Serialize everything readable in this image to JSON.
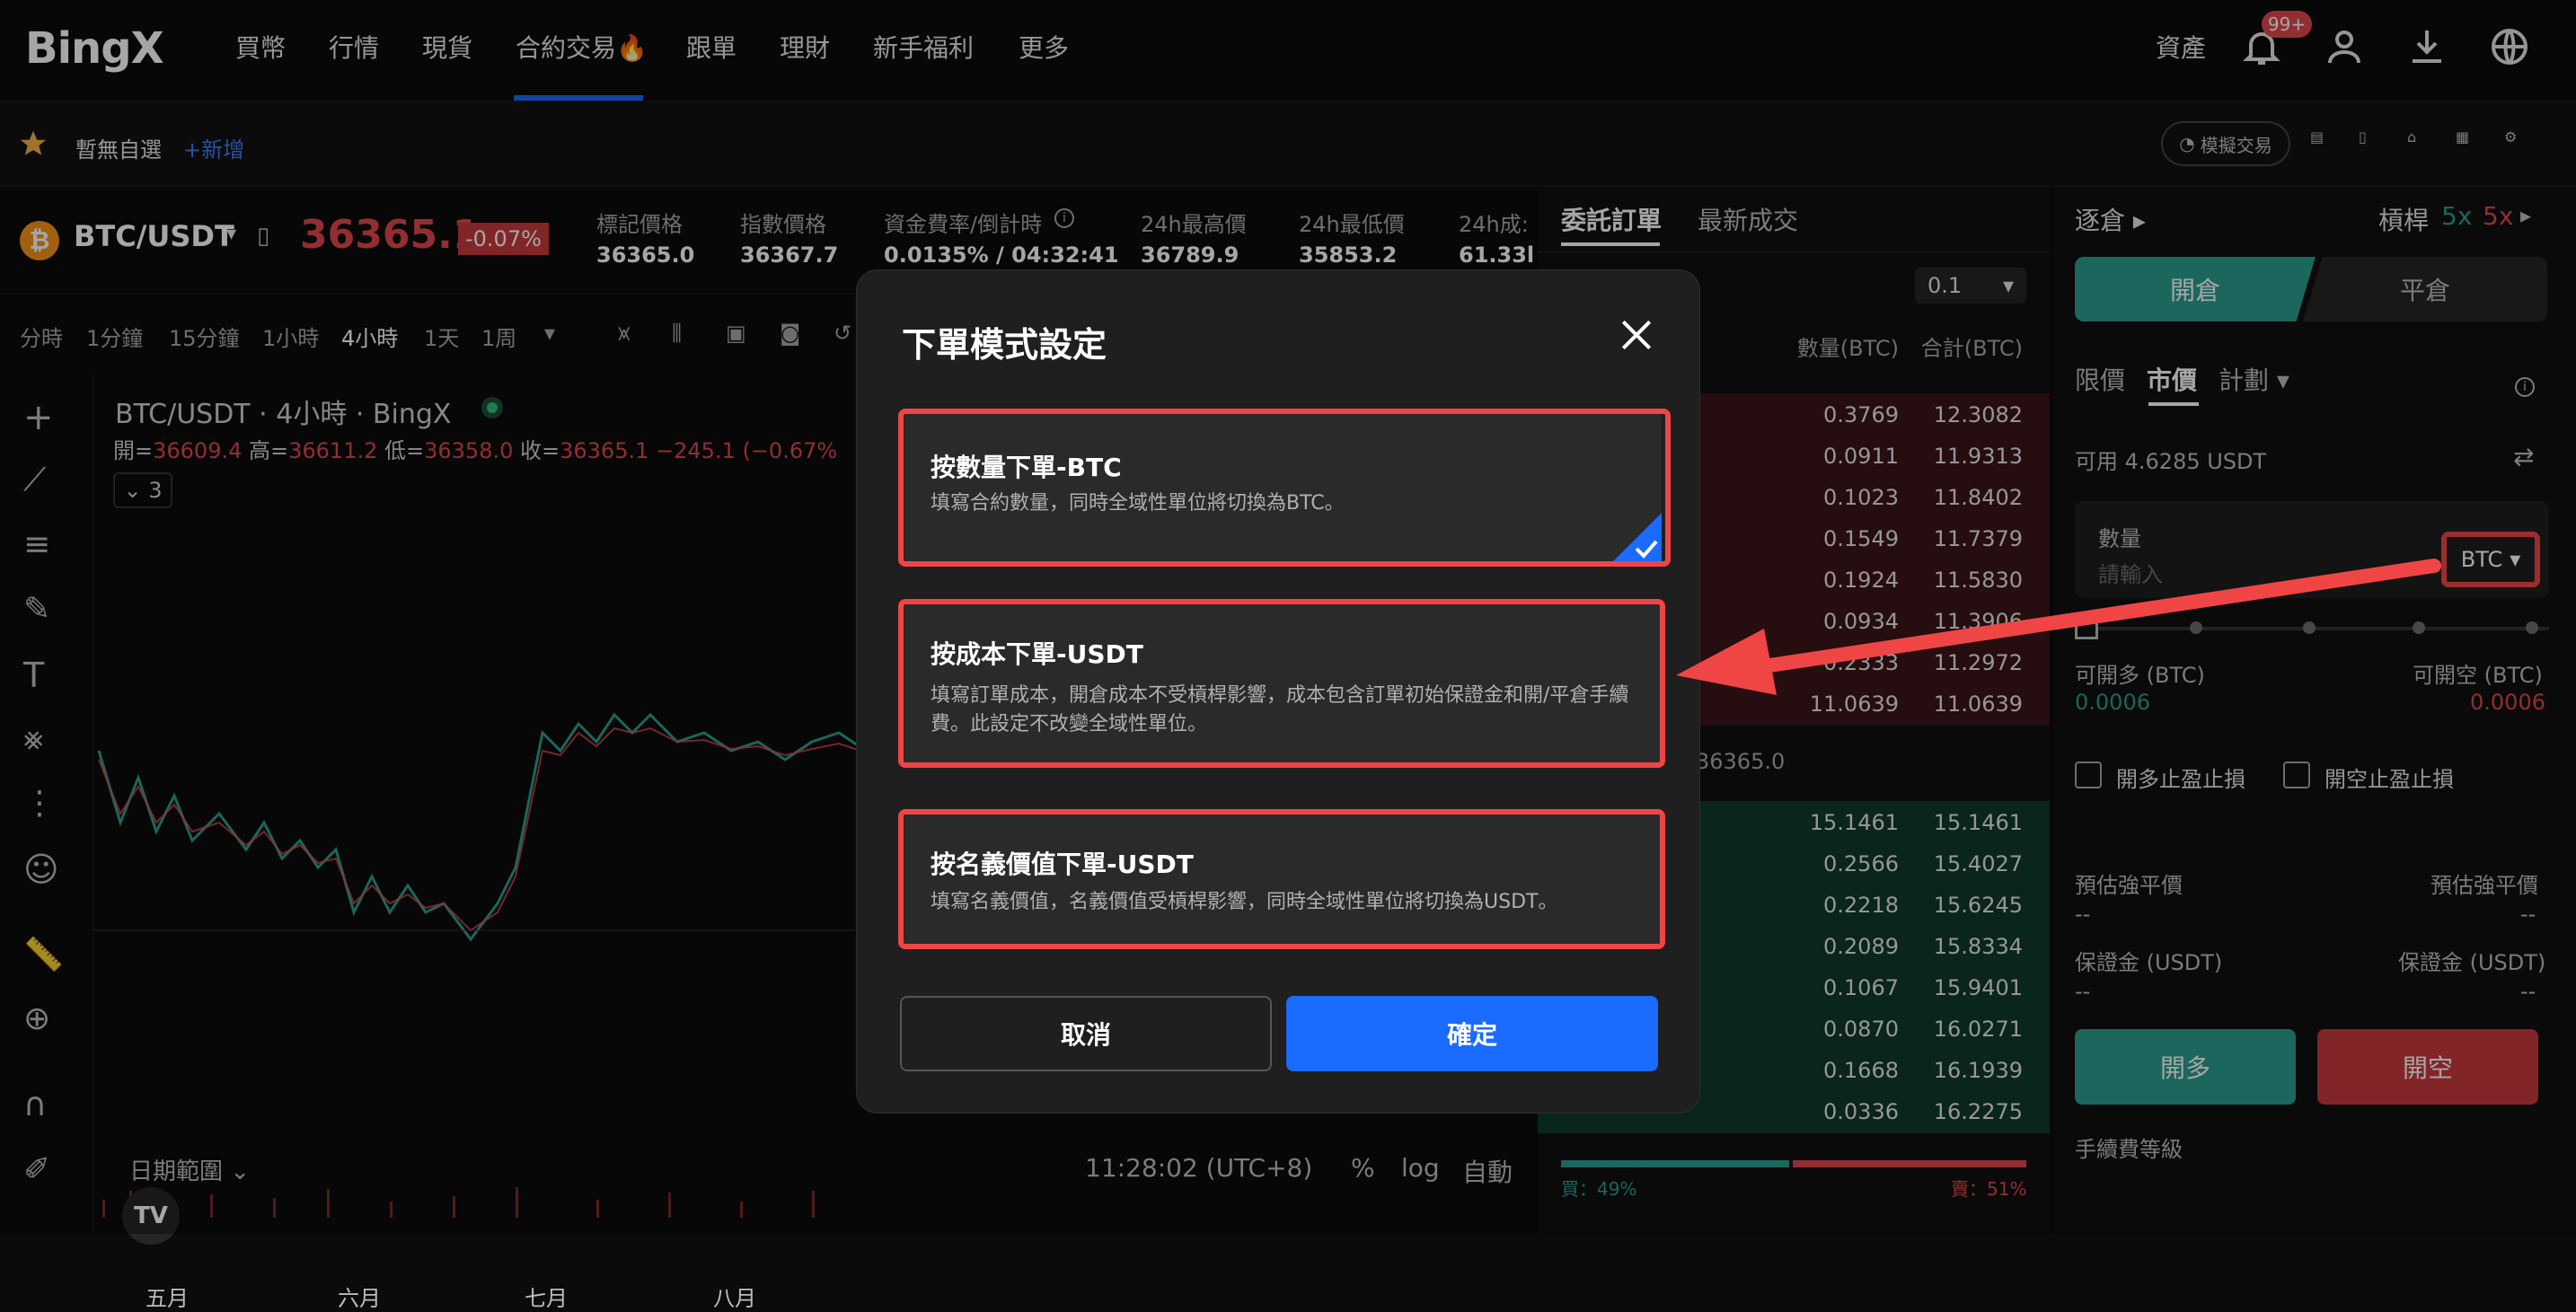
{
  "nav": {
    "logo": "BingX",
    "items": [
      "買幣",
      "行情",
      "現貨",
      "合約交易🔥",
      "跟單",
      "理財",
      "新手福利",
      "更多"
    ],
    "assets": "資產",
    "badge": "99+"
  },
  "subbar": {
    "watch": "暫無自選",
    "add": "+新增",
    "sim": "模擬交易"
  },
  "ticker": {
    "pair": "BTC/USDT",
    "price": "36365.1",
    "change": "-0.07%",
    "stats": [
      {
        "label": "標記價格",
        "value": "36365.0"
      },
      {
        "label": "指數價格",
        "value": "36367.7"
      },
      {
        "label": "資金費率/倒計時",
        "value": "0.0135% / 04:32:41"
      },
      {
        "label": "24h最高價",
        "value": "36789.9"
      },
      {
        "label": "24h最低價",
        "value": "35853.2"
      },
      {
        "label": "24h成:",
        "value": "61.33l"
      }
    ]
  },
  "timeframes": [
    "分時",
    "1分鐘",
    "15分鐘",
    "1小時",
    "4小時",
    "1天",
    "1周"
  ],
  "chart": {
    "title": "BTC/USDT · 4小時 · BingX",
    "ohlc_open_label": "開=",
    "ohlc_open": "36609.4",
    "ohlc_high_label": "高=",
    "ohlc_high": "36611.2",
    "ohlc_low_label": "低=",
    "ohlc_low": "36358.0",
    "ohlc_close_label": "收=",
    "ohlc_close": "36365.1",
    "ohlc_change": "−245.1 (−0.67%",
    "indicator_count": "3",
    "months": [
      "五月",
      "六月",
      "七月",
      "八月"
    ],
    "date_range": "日期範圍",
    "time": "11:28:02 (UTC+8)",
    "pct": "%",
    "log": "log",
    "auto": "自動"
  },
  "book": {
    "tabs": [
      "委託訂單",
      "最新成交"
    ],
    "precision": "0.1",
    "col_qty": "數量(BTC)",
    "col_total": "合計(BTC)",
    "asks": [
      [
        "0.3769",
        "12.3082"
      ],
      [
        "0.0911",
        "11.9313"
      ],
      [
        "0.1023",
        "11.8402"
      ],
      [
        "0.1549",
        "11.7379"
      ],
      [
        "0.1924",
        "11.5830"
      ],
      [
        "0.0934",
        "11.3906"
      ],
      [
        "0.2333",
        "11.2972"
      ],
      [
        "11.0639",
        "11.0639"
      ]
    ],
    "mid": "36365.0",
    "bids": [
      [
        "15.1461",
        "15.1461"
      ],
      [
        "0.2566",
        "15.4027"
      ],
      [
        "0.2218",
        "15.6245"
      ],
      [
        "0.2089",
        "15.8334"
      ],
      [
        "0.1067",
        "15.9401"
      ],
      [
        "0.0870",
        "16.0271"
      ],
      [
        "0.1668",
        "16.1939"
      ],
      [
        "0.0336",
        "16.2275"
      ]
    ],
    "buy_ratio": "買：49%",
    "sell_ratio": "賣：51%",
    "buy_fraction": 0.49
  },
  "trade": {
    "margin_mode": "逐倉",
    "leverage_label": "槓桿",
    "lev_long": "5x",
    "lev_short": "5x",
    "open_tab": "開倉",
    "close_tab": "平倉",
    "order_types": [
      "限價",
      "市價",
      "計劃"
    ],
    "available": "可用 4.6285 USDT",
    "qty_label": "數量",
    "qty_placeholder": "請輸入",
    "unit": "BTC",
    "can_long_label": "可開多 (BTC)",
    "can_long": "0.0006",
    "can_short_label": "可開空 (BTC)",
    "can_short": "0.0006",
    "tp_long": "開多止盈止損",
    "tp_short": "開空止盈止損",
    "liq_label": "預估強平價",
    "liq_val": "--",
    "margin_label": "保證金 (USDT)",
    "margin_val": "--",
    "long_btn": "開多",
    "short_btn": "開空",
    "fee_level": "手續費等級"
  },
  "modal": {
    "title": "下單模式設定",
    "options": [
      {
        "title": "按數量下單-BTC",
        "desc": "填寫合約數量，同時全域性單位將切換為BTC。"
      },
      {
        "title": "按成本下單-USDT",
        "desc": "填寫訂單成本，開倉成本不受槓桿影響，成本包含訂單初始保證金和開/平倉手續費。此設定不改變全域性單位。"
      },
      {
        "title": "按名義價值下單-USDT",
        "desc": "填寫名義價值，名義價值受槓桿影響，同時全域性單位將切換為USDT。"
      }
    ],
    "cancel": "取消",
    "confirm": "確定"
  },
  "colors": {
    "accent": "#1a6bff",
    "up": "#2a9d8f",
    "down": "#e0474c",
    "annotation": "#f04545"
  }
}
